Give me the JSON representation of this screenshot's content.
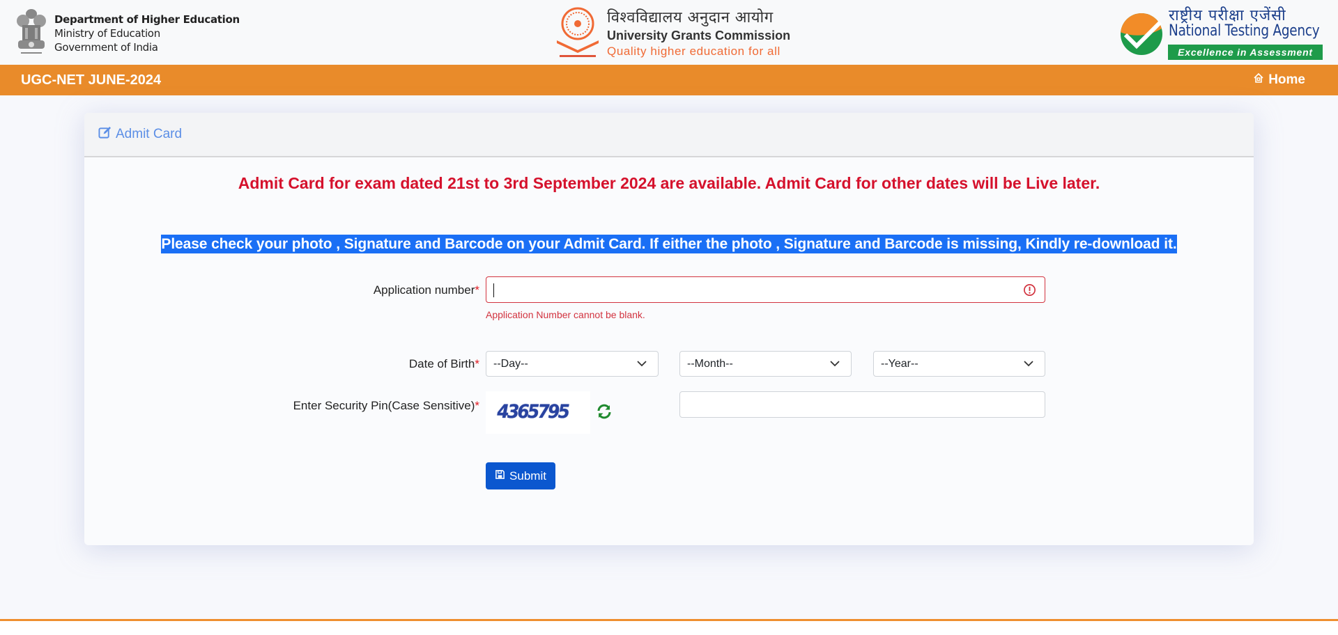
{
  "branding": {
    "gov": {
      "emblem_icon": "national-emblem-icon",
      "department": "Department of Higher Education",
      "ministry": "Ministry of Education",
      "government": "Government of India"
    },
    "ugc": {
      "logo_icon": "ugc-chakra-logo-icon",
      "hindi_name": "विश्वविद्यालय अनुदान आयोग",
      "name": "University Grants Commission",
      "tagline": "Quality higher education for all"
    },
    "nta": {
      "logo_icon": "nta-checkmark-logo-icon",
      "hindi_name": "राष्ट्रीय परीक्षा एजेंसी",
      "name": "National Testing Agency",
      "tagline": "Excellence in Assessment"
    }
  },
  "navbar": {
    "title": "UGC-NET JUNE-2024",
    "home_icon": "home-icon",
    "home_label": "Home",
    "color": "#e98b2a"
  },
  "card": {
    "header_icon": "edit-icon",
    "title": "Admit Card",
    "notice_red": "Admit Card for exam dated 21st to 3rd September 2024 are available. Admit Card for other dates will be Live later.",
    "notice_highlighted": "Please check your photo , Signature and Barcode on your Admit Card. If either the photo , Signature and Barcode is missing, Kindly re-download it."
  },
  "form": {
    "application_number": {
      "label": "Application number",
      "required_mark": "*",
      "value": "",
      "placeholder": "",
      "error_icon": "exclamation-circle-icon",
      "error_message": "Application Number cannot be blank."
    },
    "date_of_birth": {
      "label": "Date of Birth",
      "required_mark": "*",
      "day": {
        "selected": "--Day--"
      },
      "month": {
        "selected": "--Month--"
      },
      "year": {
        "selected": "--Year--"
      }
    },
    "security_pin": {
      "label": "Enter Security Pin(Case Sensitive)",
      "required_mark": "*",
      "captcha_text": "4365795",
      "refresh_icon": "refresh-icon",
      "value": ""
    },
    "submit": {
      "icon": "floppy-disk-icon",
      "label": "Submit"
    }
  },
  "colors": {
    "accent_orange": "#e98b2a",
    "error_red": "#d2333f",
    "notice_red": "#d5112c",
    "highlight_blue": "#1a6ff5",
    "primary_button": "#0b57cf",
    "title_blue": "#5b8ee6"
  }
}
